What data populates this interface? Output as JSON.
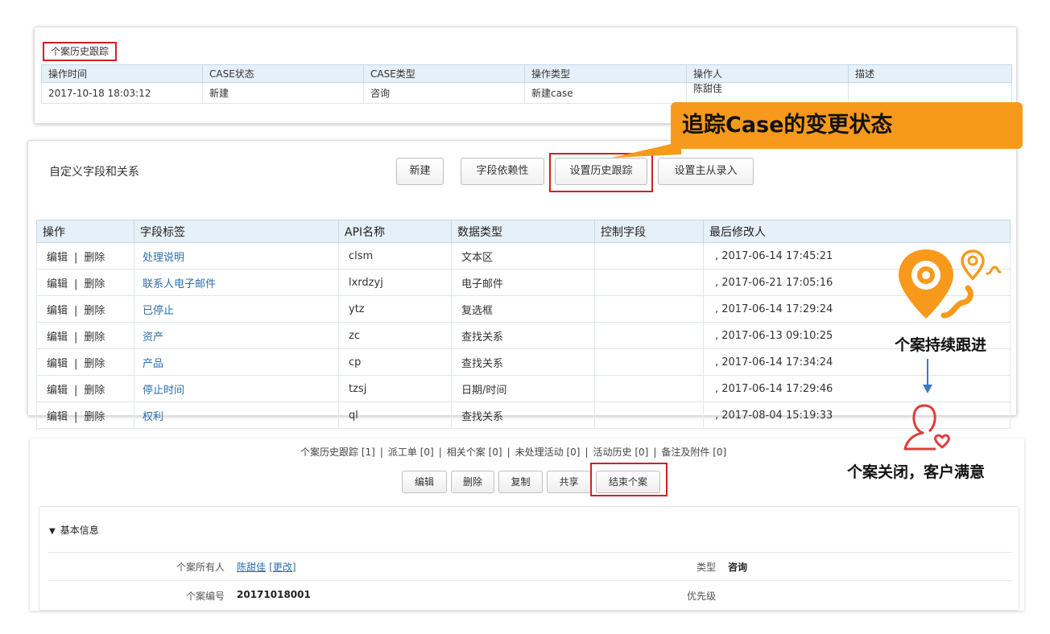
{
  "history": {
    "title": "个案历史跟踪",
    "columns": [
      "操作时间",
      "CASE状态",
      "CASE类型",
      "操作类型",
      "操作人",
      "描述"
    ],
    "rows": [
      [
        "2017-10-18 18:03:12",
        "新建",
        "咨询",
        "新建case",
        "陈甜佳",
        ""
      ]
    ]
  },
  "callout": {
    "text": "追踪Case的变更状态"
  },
  "fields": {
    "title": "自定义字段和关系",
    "buttons": {
      "new": "新建",
      "deps": "字段依赖性",
      "history": "设置历史跟踪",
      "master": "设置主从录入"
    },
    "columns": [
      "操作",
      "字段标签",
      "API名称",
      "数据类型",
      "控制字段",
      "最后修改人"
    ],
    "op_edit": "编辑",
    "op_sep": "|",
    "op_delete": "删除",
    "rows": [
      {
        "label": "处理说明",
        "api": "clsm",
        "type": "文本区",
        "ctrl": "",
        "modified": ", 2017-06-14 17:45:21"
      },
      {
        "label": "联系人电子邮件",
        "api": "lxrdzyj",
        "type": "电子邮件",
        "ctrl": "",
        "modified": ", 2017-06-21 17:05:16"
      },
      {
        "label": "已停止",
        "api": "ytz",
        "type": "复选框",
        "ctrl": "",
        "modified": ", 2017-06-14 17:29:24"
      },
      {
        "label": "资产",
        "api": "zc",
        "type": "查找关系",
        "ctrl": "",
        "modified": ", 2017-06-13 09:10:25"
      },
      {
        "label": "产品",
        "api": "cp",
        "type": "查找关系",
        "ctrl": "",
        "modified": ", 2017-06-14 17:34:24"
      },
      {
        "label": "停止时间",
        "api": "tzsj",
        "type": "日期/时间",
        "ctrl": "",
        "modified": ", 2017-06-14 17:29:46"
      },
      {
        "label": "权利",
        "api": "ql",
        "type": "查找关系",
        "ctrl": "",
        "modified": ", 2017-08-04 15:19:33"
      }
    ]
  },
  "related": {
    "links": [
      "个案历史跟踪 [1]",
      "派工单 [0]",
      "相关个案 [0]",
      "未处理活动 [0]",
      "活动历史 [0]",
      "备注及附件 [0]"
    ],
    "sep": "|"
  },
  "actions": {
    "edit": "编辑",
    "delete": "删除",
    "copy": "复制",
    "share": "共享",
    "close": "结束个案"
  },
  "detail": {
    "section": "基本信息",
    "owner_label": "个案所有人",
    "owner_value": "陈甜佳",
    "owner_change": "[更改]",
    "type_label": "类型",
    "type_value": "咨询",
    "number_label": "个案编号",
    "number_value": "20171018001",
    "priority_label": "优先级",
    "priority_value": ""
  },
  "annotations": {
    "follow": "个案持续跟进",
    "closed": "个案关闭，客户满意"
  },
  "colors": {
    "accent_orange": "#f79a1b",
    "highlight_red": "#d32020",
    "link_blue": "#2a6fb0",
    "header_bg": "#e6f0f9"
  },
  "icons": [
    "location-pin-icon",
    "small-location-pin-icon",
    "down-arrow-icon",
    "satisfied-customer-icon"
  ]
}
